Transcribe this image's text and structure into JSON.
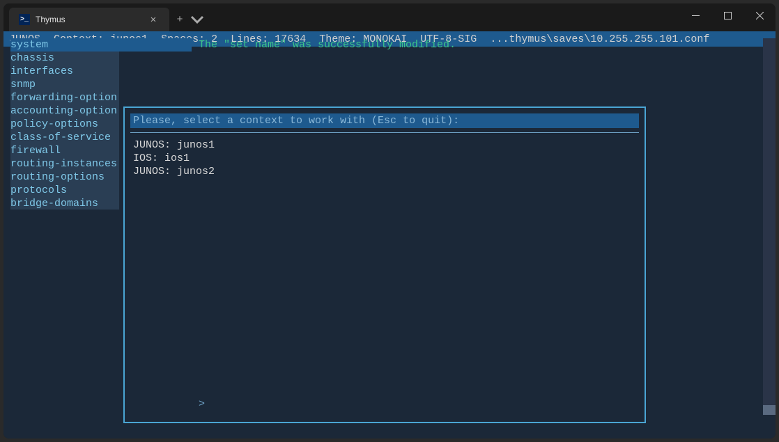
{
  "window": {
    "tab_title": "Thymus",
    "icon_glyph": ">_"
  },
  "message": "The \"set name\" was successfully modified.",
  "sidebar": {
    "items": [
      "system",
      "chassis",
      "interfaces",
      "snmp",
      "forwarding-option",
      "accounting-option",
      "policy-options",
      "class-of-service",
      "firewall",
      "routing-instances",
      "routing-options",
      "protocols",
      "bridge-domains"
    ],
    "selected_index": 0
  },
  "modal": {
    "title": "Please, select a context to work with (Esc to quit):",
    "items": [
      "JUNOS: junos1",
      "IOS: ios1",
      "JUNOS: junos2"
    ]
  },
  "prompt": ">",
  "status": {
    "platform": "JUNOS",
    "context_label": "Context:",
    "context_value": "junos1",
    "spaces_label": "Spaces:",
    "spaces_value": "2",
    "lines_label": "Lines:",
    "lines_value": "17634",
    "theme_label": "Theme:",
    "theme_value": "MONOKAI",
    "encoding": "UTF-8-SIG",
    "path": "...thymus\\saves\\10.255.255.101.conf"
  }
}
